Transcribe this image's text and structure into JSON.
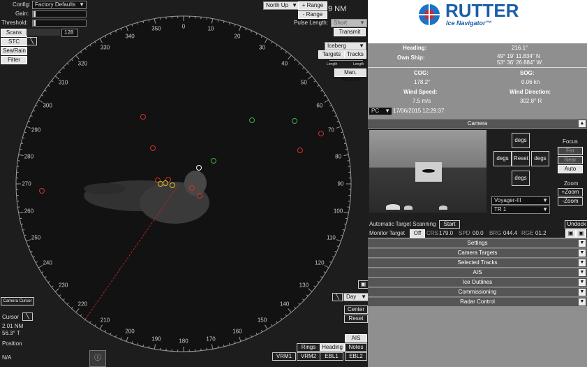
{
  "radar": {
    "config_label": "Config:",
    "config_value": "Factory Defaults",
    "gain_label": "Gain:",
    "threshold_label": "Threshold:",
    "scans_label": "Scans",
    "scans_value": "128",
    "stc_label": "STC",
    "sea_rain_label": "Sea/Rain",
    "filter_label": "Filter",
    "orientation": "North Up",
    "range_up": "+ Range",
    "range_down": "- Range",
    "range_value": "9 NM",
    "pulse_label": "Pulse Length:",
    "pulse_value": "Short",
    "transmit_label": "Transmit",
    "target_type": "Iceberg",
    "targets_label": "Targets",
    "tracks_label": "Tracks",
    "slider_min": "Length",
    "slider_max": "Length",
    "man_acquire": "Man. Acquire",
    "camera_cursor": "Camera Cursor",
    "cursor_label": "Cursor",
    "cursor_range": "2.01 NM",
    "cursor_bearing": "56.3° T",
    "position_label": "Position",
    "position_value": "N/A",
    "day_label": "Day",
    "center_label": "Center",
    "reset_label": "Reset",
    "ais_label": "AIS",
    "rings_label": "Rings",
    "heading_label": "Heading",
    "notes_label": "Notes",
    "vrm1": "VRM1",
    "vrm2": "VRM2",
    "ebl1": "EBL1",
    "ebl2": "EBL2",
    "info_icon": "info-icon",
    "bearings": [
      "0",
      "10",
      "20",
      "30",
      "40",
      "50",
      "60",
      "70",
      "80",
      "90",
      "100",
      "110",
      "120",
      "130",
      "140",
      "150",
      "160",
      "170",
      "180",
      "190",
      "200",
      "210",
      "220",
      "230",
      "240",
      "250",
      "260",
      "270",
      "280",
      "290",
      "300",
      "310",
      "320",
      "330",
      "340",
      "350"
    ]
  },
  "brand": {
    "name": "RUTTER",
    "product": "Ice Navigator™",
    "logo_colors": [
      "#1a73c8",
      "#d62828"
    ]
  },
  "ship": {
    "heading_label": "Heading:",
    "heading_value": "216.1°",
    "own_ship_label": "Own Ship:",
    "lat": "49° 19' 11.834\" N",
    "lon": "53° 36' 26.884\" W",
    "cog_label": "COG:",
    "cog_value": "178.2°",
    "sog_label": "SOG:",
    "sog_value": "0.06 kn",
    "wind_speed_label": "Wind Speed:",
    "wind_speed_value": "7.5 m/s",
    "wind_dir_label": "Wind Direction:",
    "wind_dir_value": "302.8° R",
    "pc_label": "PC",
    "datetime": "17/06/2015 12:29:37"
  },
  "camera": {
    "header": "Camera",
    "degs_up": "degs",
    "degs_left": "degs",
    "reset": "Reset",
    "degs_right": "degs",
    "degs_down": "degs",
    "focus_label": "Focus",
    "far": "Far",
    "near": "Near",
    "auto": "Auto",
    "zoom_label": "Zoom",
    "zoom_in": "+Zoom",
    "zoom_out": "-Zoom",
    "camera_select": "Voyager-III",
    "track_select": "TR 1",
    "auto_scan_label": "Automatic Target Scanning",
    "start": "Start",
    "undock": "Undock",
    "monitor_label": "Monitor Target",
    "monitor_value": "Off",
    "crs_label": "CRS",
    "crs_value": "179.0",
    "spd_label": "SPD",
    "spd_value": "00.0",
    "brg_label": "BRG",
    "brg_value": "044.4",
    "rge_label": "RGE",
    "rge_value": "01.2"
  },
  "sections": [
    "Settings",
    "Camera Targets",
    "Selected Tracks",
    "AIS",
    "Ice Outlines",
    "Commissioning",
    "Radar Control"
  ]
}
